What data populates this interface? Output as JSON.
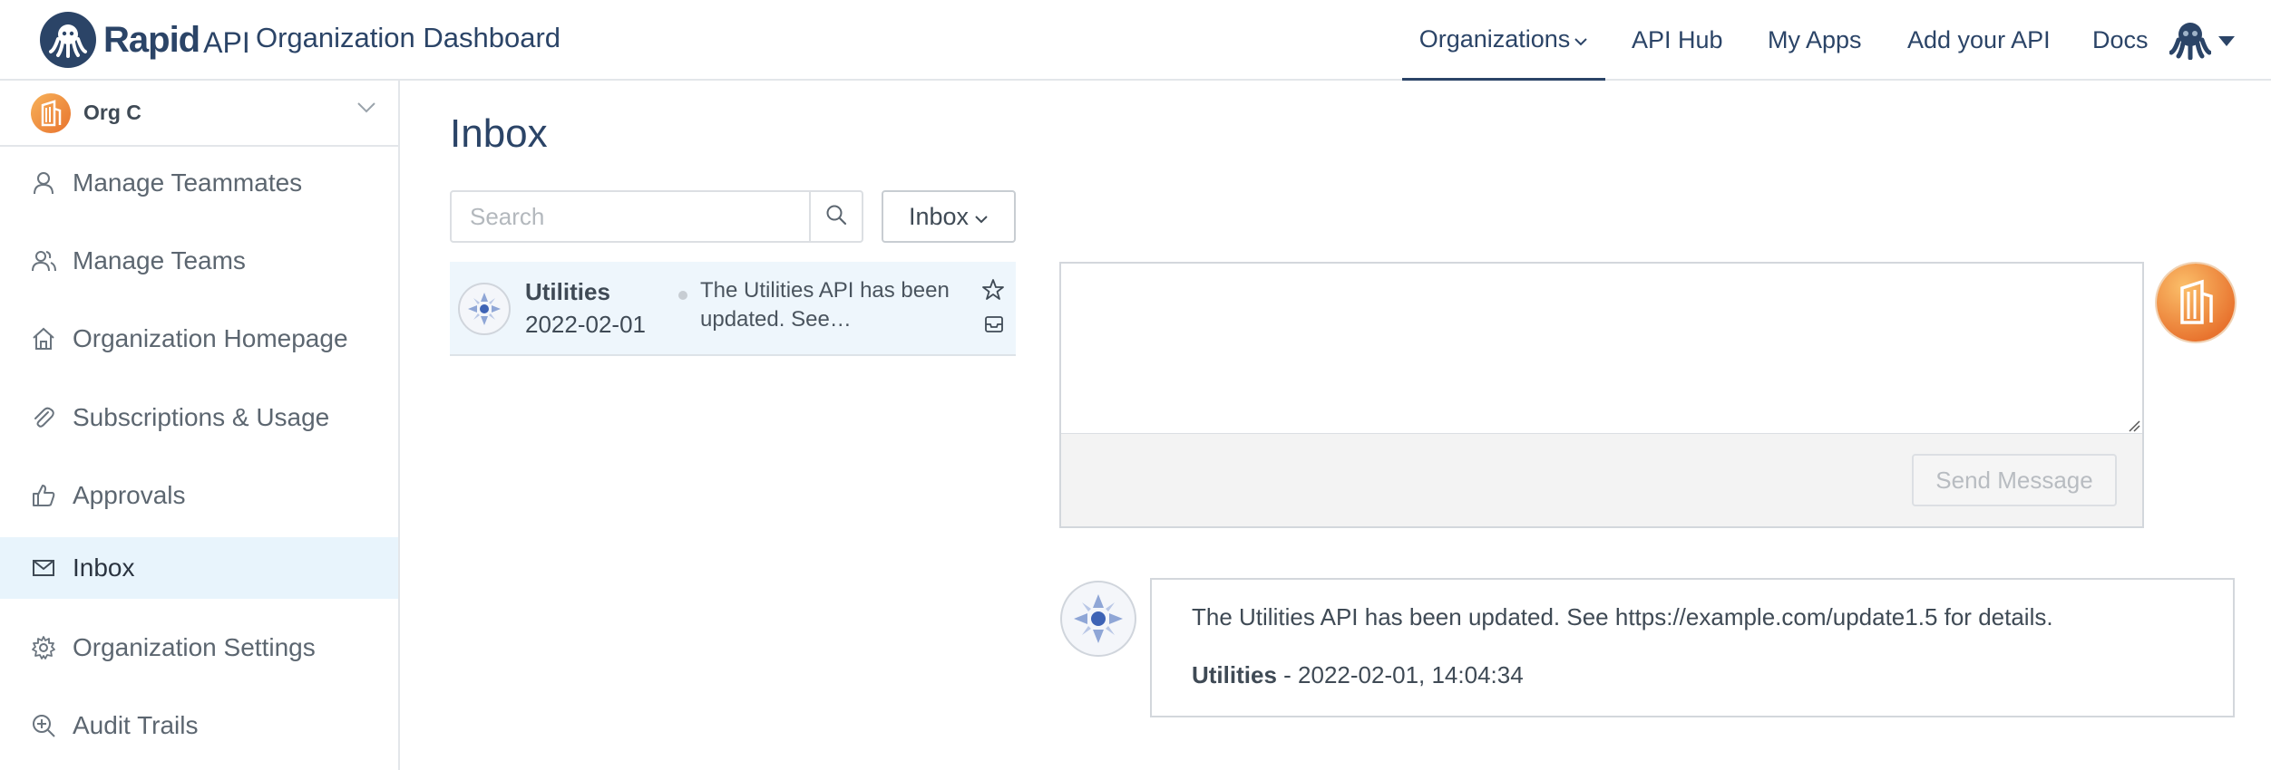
{
  "header": {
    "logo_text": "Rapid",
    "logo_suffix": "API",
    "app_title": "Organization Dashboard",
    "nav": [
      {
        "label": "Organizations"
      },
      {
        "label": "API Hub"
      },
      {
        "label": "My Apps"
      },
      {
        "label": "Add your API"
      },
      {
        "label": "Docs"
      }
    ],
    "brand_color": "#2b4467"
  },
  "sidebar": {
    "org_name": "Org C",
    "items": [
      {
        "label": "Manage Teammates",
        "icon": "user-icon"
      },
      {
        "label": "Manage Teams",
        "icon": "users-icon"
      },
      {
        "label": "Organization Homepage",
        "icon": "home-icon"
      },
      {
        "label": "Subscriptions & Usage",
        "icon": "paperclip-icon"
      },
      {
        "label": "Approvals",
        "icon": "thumbs-up-icon"
      },
      {
        "label": "Inbox",
        "icon": "mail-icon",
        "active": true
      },
      {
        "label": "Organization Settings",
        "icon": "gear-icon"
      },
      {
        "label": "Audit Trails",
        "icon": "zoom-plus-icon"
      }
    ],
    "active_color": "#e8f4fc"
  },
  "main": {
    "title": "Inbox",
    "search": {
      "placeholder": "Search",
      "value": ""
    },
    "filter_label": "Inbox",
    "messages": [
      {
        "sender": "Utilities",
        "date": "2022-02-01",
        "preview": "The Utilities API has been updated. See…"
      }
    ],
    "composer": {
      "value": "",
      "send_label": "Send Message"
    },
    "thread": {
      "body": "The Utilities API has been updated. See https://example.com/update1.5 for details.",
      "sender": "Utilities",
      "timestamp": " - 2022-02-01, 14:04:34"
    }
  }
}
